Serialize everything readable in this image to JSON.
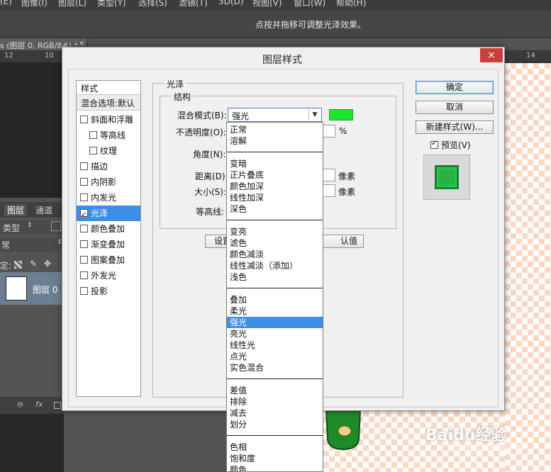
{
  "menu": [
    "(E)",
    "图像(I)",
    "图层(L)",
    "类型(Y)",
    "选择(S)",
    "滤镜(T)",
    "3D(D)",
    "视图(V)",
    "窗口(W)",
    "帮助(H)"
  ],
  "options_hint": "点按并拖移可调整光泽效果。",
  "doc_tab": "s (图层 0, RGB/8#) *",
  "doc_tab_close": "×",
  "ruler_ticks": [
    "12",
    "10",
    "14"
  ],
  "layers_panel": {
    "tab_layers": "图层",
    "tab_channels": "通道",
    "filter_kind": "类型",
    "blend_mode": "常",
    "lock_label": "定:",
    "layer_name": "图层 0",
    "footer_fx": "fx"
  },
  "dialog": {
    "title": "图层样式",
    "close": "×",
    "styles_header": "样式",
    "blend_options": "混合选项:默认",
    "styles": [
      {
        "label": "斜面和浮雕",
        "checked": false,
        "indent": false
      },
      {
        "label": "等高线",
        "checked": false,
        "indent": true
      },
      {
        "label": "纹理",
        "checked": false,
        "indent": true
      },
      {
        "label": "描边",
        "checked": false,
        "indent": false
      },
      {
        "label": "内阴影",
        "checked": false,
        "indent": false
      },
      {
        "label": "内发光",
        "checked": false,
        "indent": false
      },
      {
        "label": "光泽",
        "checked": true,
        "indent": false,
        "active": true
      },
      {
        "label": "颜色叠加",
        "checked": false,
        "indent": false
      },
      {
        "label": "渐变叠加",
        "checked": false,
        "indent": false
      },
      {
        "label": "图案叠加",
        "checked": false,
        "indent": false
      },
      {
        "label": "外发光",
        "checked": false,
        "indent": false
      },
      {
        "label": "投影",
        "checked": false,
        "indent": false
      }
    ],
    "section_title": "光泽",
    "structure_title": "结构",
    "blend_mode_label": "混合模式(B):",
    "blend_mode_value": "强光",
    "swatch_color": "#1ee62c",
    "opacity_label": "不透明度(O):",
    "opacity_unit": "%",
    "angle_label": "角度(N):",
    "distance_label": "距离(D):",
    "distance_unit": "像素",
    "size_label": "大小(S):",
    "size_unit": "像素",
    "contour_label": "等高线:",
    "set_default_partial": "设置",
    "reset_default_partial": "认值",
    "ok": "确定",
    "cancel": "取消",
    "new_style": "新建样式(W)...",
    "preview_label": "预览(V)",
    "preview_checked": true
  },
  "dropdown_groups": [
    [
      "正常",
      "溶解"
    ],
    [
      "变暗",
      "正片叠底",
      "颜色加深",
      "线性加深",
      "深色"
    ],
    [
      "变亮",
      "滤色",
      "颜色减淡",
      "线性减淡（添加）",
      "浅色"
    ],
    [
      "叠加",
      "柔光",
      "强光",
      "亮光",
      "线性光",
      "点光",
      "实色混合"
    ],
    [
      "差值",
      "排除",
      "减去",
      "划分"
    ],
    [
      "色相",
      "饱和度",
      "颜色"
    ]
  ],
  "dropdown_selected": "强光",
  "selection_color": "#3d8fe6",
  "watermark": "Baidu经验",
  "watermark_sub": "jingyan.baidu.com"
}
